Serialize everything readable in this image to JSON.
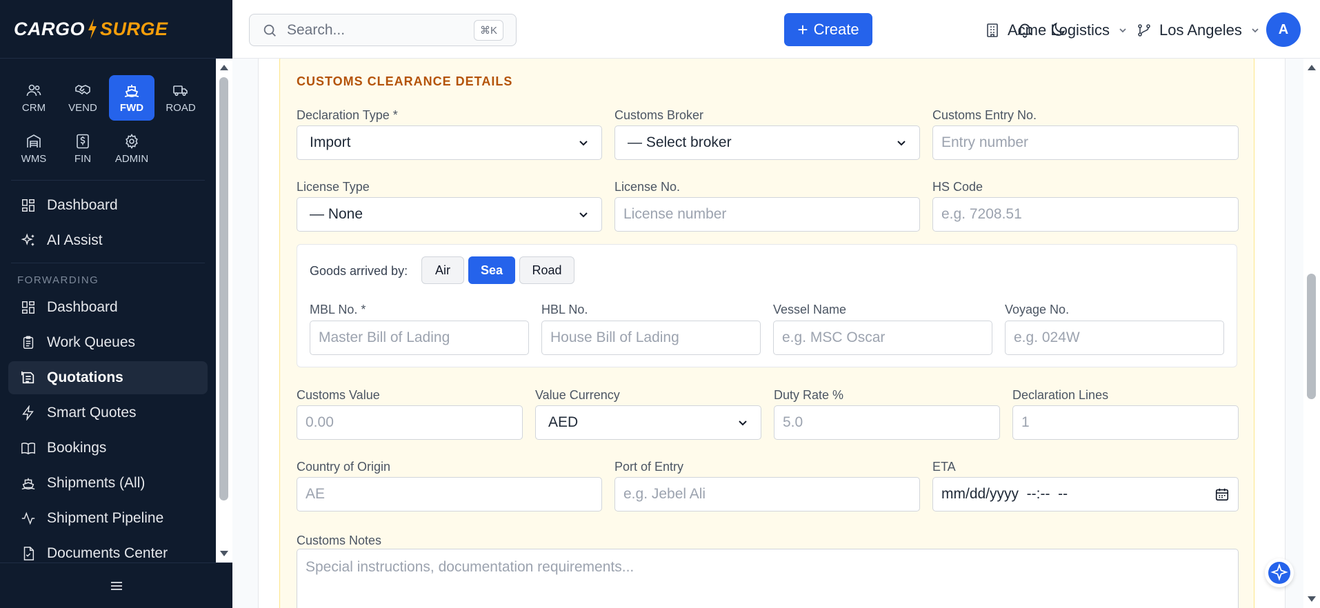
{
  "brand": {
    "part1": "CARGO",
    "part2": "SURGE"
  },
  "modules": [
    {
      "label": "CRM",
      "icon": "users-icon"
    },
    {
      "label": "VEND",
      "icon": "handshake-icon"
    },
    {
      "label": "FWD",
      "icon": "ship-icon",
      "active": true
    },
    {
      "label": "ROAD",
      "icon": "truck-icon"
    },
    {
      "label": "WMS",
      "icon": "warehouse-icon"
    },
    {
      "label": "FIN",
      "icon": "receipt-icon"
    },
    {
      "label": "ADMIN",
      "icon": "gear-icon"
    }
  ],
  "nav_top": [
    {
      "label": "Dashboard",
      "icon": "dashboard-icon"
    },
    {
      "label": "AI Assist",
      "icon": "sparkle-icon"
    }
  ],
  "nav_section": "FORWARDING",
  "nav_forwarding": [
    {
      "label": "Dashboard",
      "icon": "dashboard-icon"
    },
    {
      "label": "Work Queues",
      "icon": "clipboard-icon"
    },
    {
      "label": "Quotations",
      "icon": "quotation-icon",
      "active": true
    },
    {
      "label": "Smart Quotes",
      "icon": "bolt-icon"
    },
    {
      "label": "Bookings",
      "icon": "book-icon"
    },
    {
      "label": "Shipments (All)",
      "icon": "ship-icon"
    },
    {
      "label": "Shipment Pipeline",
      "icon": "pulse-icon"
    },
    {
      "label": "Documents Center",
      "icon": "document-icon"
    }
  ],
  "topbar": {
    "search_placeholder": "Search...",
    "search_shortcut": "⌘K",
    "create_label": "Create",
    "company": "Acme Logistics",
    "branch": "Los Angeles",
    "avatar_initial": "A"
  },
  "customs": {
    "title": "CUSTOMS CLEARANCE DETAILS",
    "declaration_type_label": "Declaration Type *",
    "declaration_type_value": "Import",
    "customs_broker_label": "Customs Broker",
    "customs_broker_value": "— Select broker",
    "customs_entry_label": "Customs Entry No.",
    "customs_entry_placeholder": "Entry number",
    "license_type_label": "License Type",
    "license_type_value": "— None",
    "license_no_label": "License No.",
    "license_no_placeholder": "License number",
    "hs_code_label": "HS Code",
    "hs_code_placeholder": "e.g. 7208.51",
    "goods_arrived_label": "Goods arrived by:",
    "modes": [
      "Air",
      "Sea",
      "Road"
    ],
    "active_mode": "Sea",
    "mbl_label": "MBL No. *",
    "mbl_placeholder": "Master Bill of Lading",
    "hbl_label": "HBL No.",
    "hbl_placeholder": "House Bill of Lading",
    "vessel_label": "Vessel Name",
    "vessel_placeholder": "e.g. MSC Oscar",
    "voyage_label": "Voyage No.",
    "voyage_placeholder": "e.g. 024W",
    "customs_value_label": "Customs Value",
    "customs_value_placeholder": "0.00",
    "value_currency_label": "Value Currency",
    "value_currency_value": "AED",
    "duty_rate_label": "Duty Rate %",
    "duty_rate_placeholder": "5.0",
    "declaration_lines_label": "Declaration Lines",
    "declaration_lines_placeholder": "1",
    "origin_label": "Country of Origin",
    "origin_placeholder": "AE",
    "port_label": "Port of Entry",
    "port_placeholder": "e.g. Jebel Ali",
    "eta_label": "ETA",
    "eta_placeholder": "mm/dd/yyyy  --:--  --",
    "notes_label": "Customs Notes",
    "notes_placeholder": "Special instructions, documentation requirements..."
  },
  "colors": {
    "sidebar_bg": "#0f1b2d",
    "accent": "#2563eb",
    "section_bg": "#fffbeb",
    "section_title": "#b45309"
  }
}
